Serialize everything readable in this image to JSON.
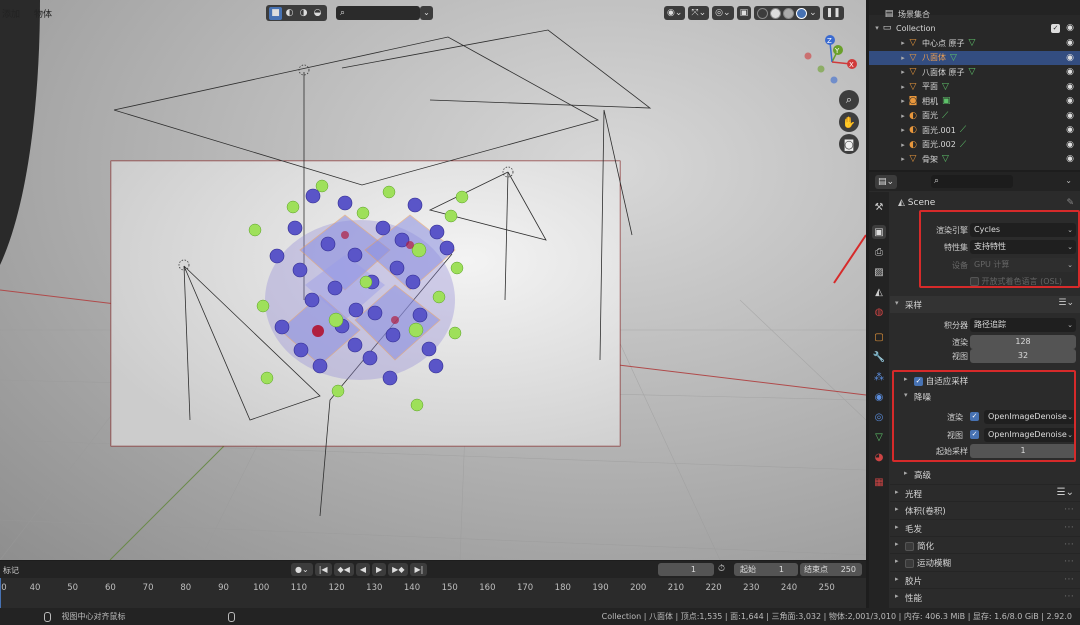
{
  "viewport": {
    "menu": [
      "添加",
      "物体"
    ],
    "nav_gizmo": {
      "x": "X",
      "y": "Y",
      "z": "Z"
    }
  },
  "outliner": {
    "root": "场景集合",
    "collection": "Collection",
    "items": [
      {
        "label": "中心点 原子",
        "selected": false
      },
      {
        "label": "八面体",
        "selected": true
      },
      {
        "label": "八面体 原子",
        "selected": false
      },
      {
        "label": "平面",
        "selected": false
      },
      {
        "label": "相机",
        "selected": false
      },
      {
        "label": "面光",
        "selected": false
      },
      {
        "label": "面光.001",
        "selected": false
      },
      {
        "label": "面光.002",
        "selected": false
      },
      {
        "label": "骨架",
        "selected": false
      }
    ]
  },
  "properties": {
    "scene_name": "Scene",
    "render_engine": {
      "label": "渲染引擎",
      "value": "Cycles"
    },
    "feature_set": {
      "label": "特性集",
      "value": "支持特性"
    },
    "device": {
      "label": "设备",
      "value": "GPU 计算"
    },
    "osl": {
      "label": "开放式着色语言 (OSL)"
    },
    "sampling_panel": "采样",
    "integrator": {
      "label": "积分器",
      "value": "路径追踪"
    },
    "render_samples": {
      "label": "渲染",
      "value": "128"
    },
    "viewport_samples": {
      "label": "视图",
      "value": "32"
    },
    "adaptive_sampling": "自适应采样",
    "denoise_panel": "降噪",
    "denoise_render": {
      "label": "渲染",
      "value": "OpenImageDenoise"
    },
    "denoise_viewport": {
      "label": "视图",
      "value": "OpenImageDenoise"
    },
    "start_sample": {
      "label": "起始采样",
      "value": "1"
    },
    "advanced": "高级",
    "panels": [
      "光程",
      "体积(卷积)",
      "毛发",
      "简化",
      "运动模糊",
      "胶片",
      "性能"
    ]
  },
  "timeline": {
    "marker_label": "标记",
    "current_frame": "1",
    "start_label": "起始",
    "start_value": "1",
    "end_label": "结束点",
    "end_value": "250",
    "ticks": [
      "0",
      "40",
      "50",
      "60",
      "70",
      "80",
      "90",
      "100",
      "110",
      "120",
      "130",
      "140",
      "150",
      "160",
      "170",
      "180",
      "190",
      "200",
      "210",
      "220",
      "230",
      "240",
      "250"
    ]
  },
  "statusbar": {
    "hint": "视图中心对齐鼠标",
    "stats": "Collection | 八面体 | 顶点:1,535 | 面:1,644 | 三角面:3,032 | 物体:2,001/3,010 | 内存: 406.3 MiB | 显存: 1.6/8.0 GiB | 2.92.0"
  },
  "colors": {
    "accent": "#4772b3",
    "highlight": "#d62a2a",
    "selected_row": "#334d80"
  }
}
